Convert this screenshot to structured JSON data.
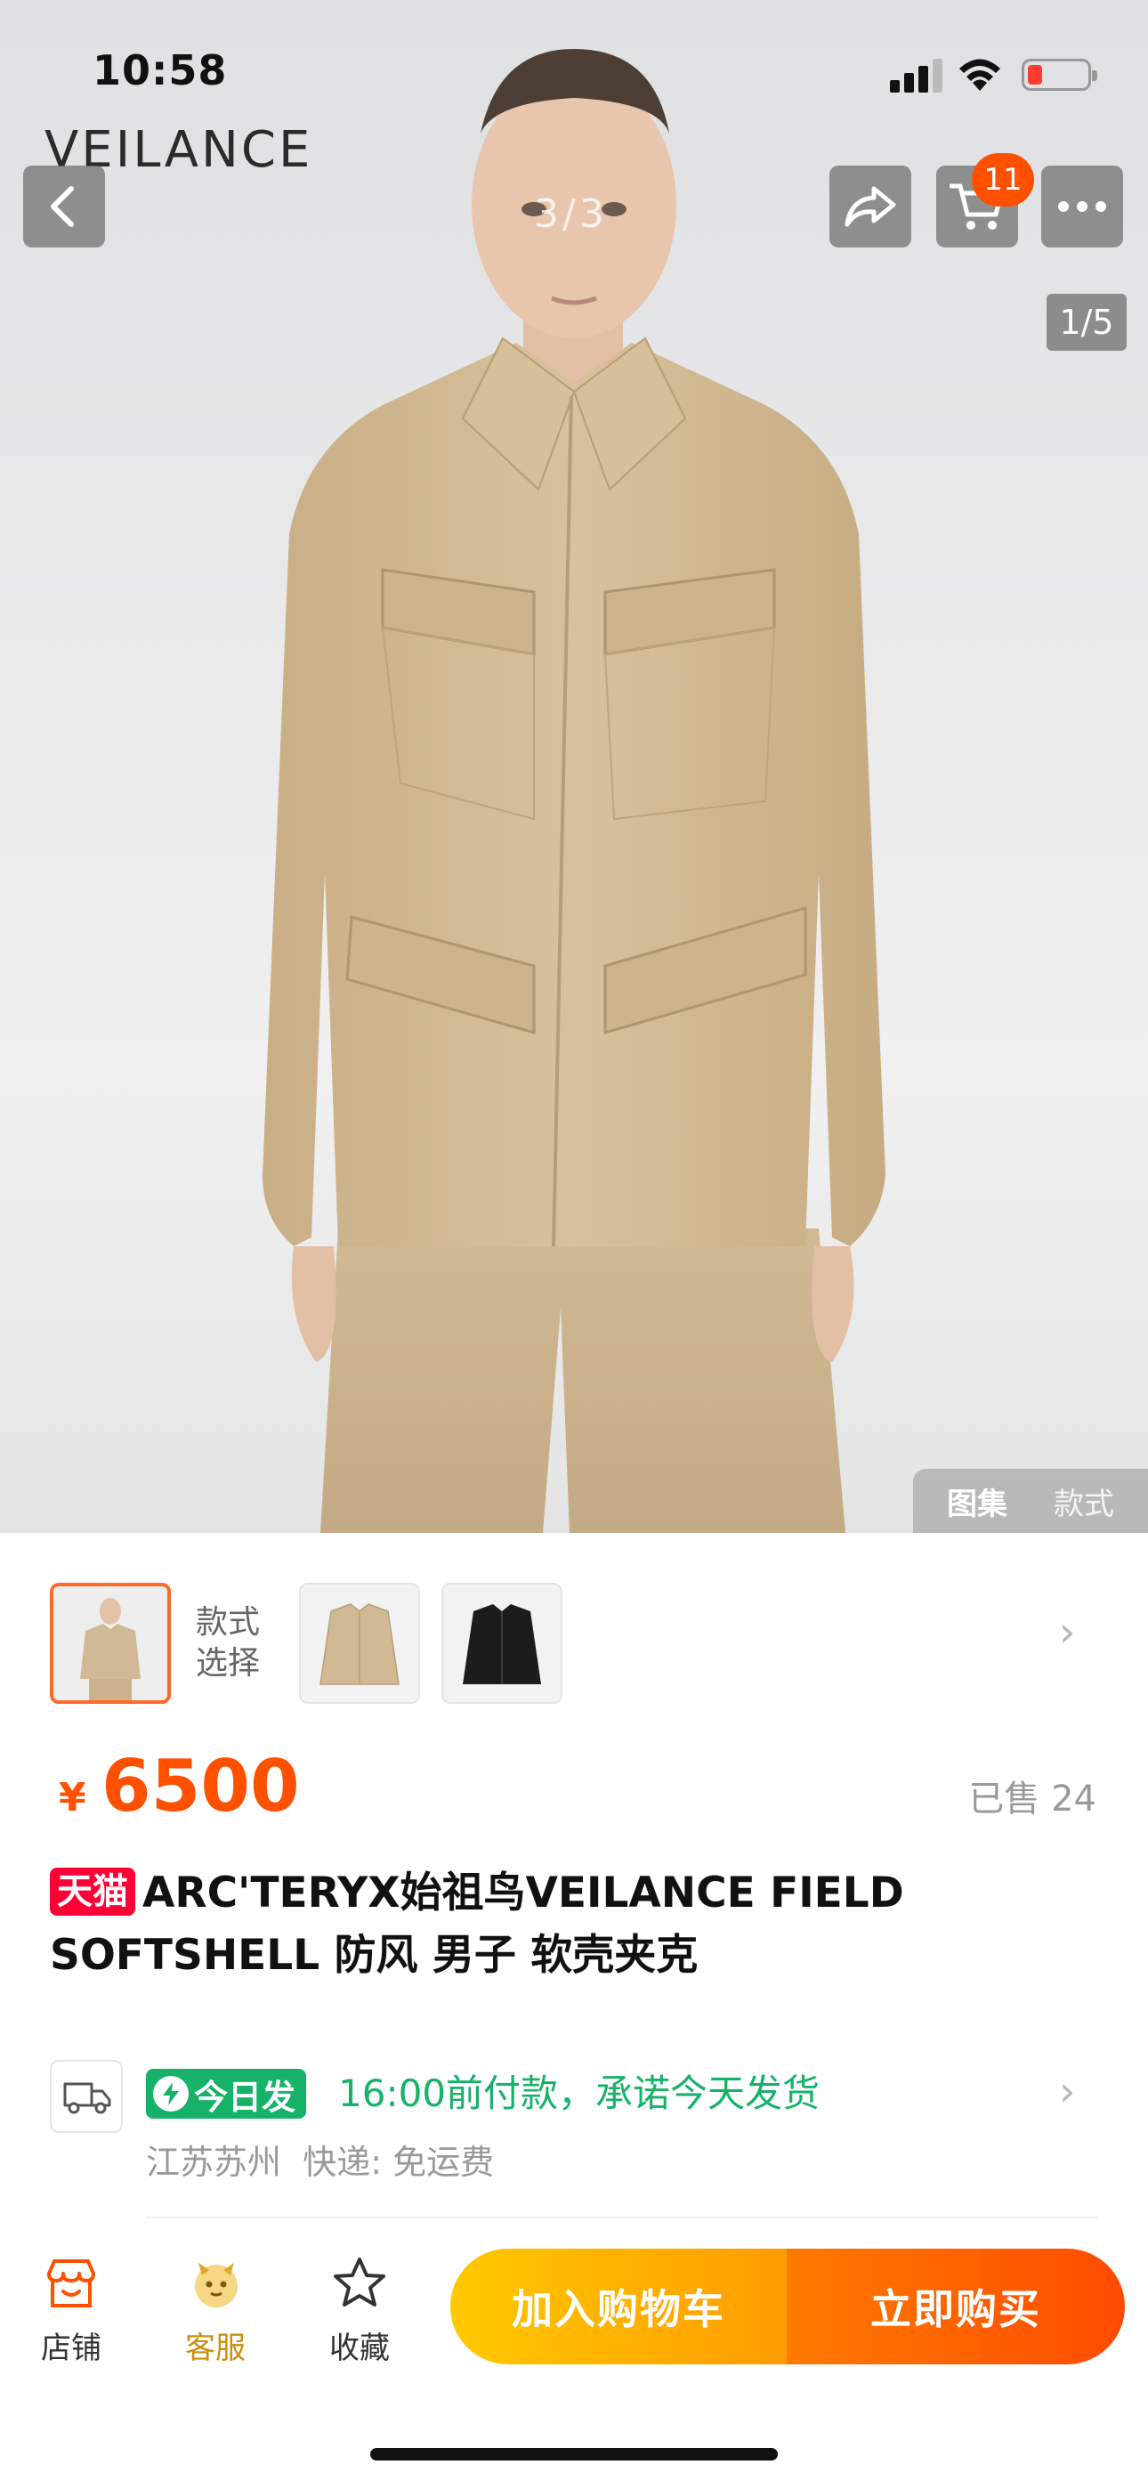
{
  "status_bar": {
    "time": "10:58"
  },
  "hero": {
    "brand_logo": "VEILANCE",
    "cart_badge": "11",
    "overlay_counter": "3/3",
    "page_indicator": "1/5",
    "gallery_tabs": {
      "active": "图集",
      "inactive": "款式"
    }
  },
  "style_selector": {
    "label": "款式选择",
    "thumbnails": [
      {
        "name": "khaki jacket on model",
        "selected": true
      },
      {
        "name": "khaki jacket"
      },
      {
        "name": "black jacket"
      }
    ]
  },
  "price": {
    "symbol": "¥",
    "value": "6500",
    "sold": "已售 24"
  },
  "title": {
    "tag": "天猫",
    "text": "ARC'TERYX始祖鸟VEILANCE FIELD SOFTSHELL 防风 男子 软壳夹克"
  },
  "delivery": {
    "tag": "今日发",
    "promise": "16:00前付款，承诺今天发货",
    "origin": "江苏苏州",
    "shipping": "快递: 免运费"
  },
  "bottom_bar": {
    "shop": "店铺",
    "service": "客服",
    "favorite": "收藏",
    "add_to_cart": "加入购物车",
    "buy_now": "立即购买"
  },
  "colors": {
    "accent_orange": "#ff5000",
    "tmall_red": "#ff0036",
    "delivery_green": "#17b26a",
    "cart_yellow": "#ffc900",
    "product_khaki": "#d2b995"
  }
}
